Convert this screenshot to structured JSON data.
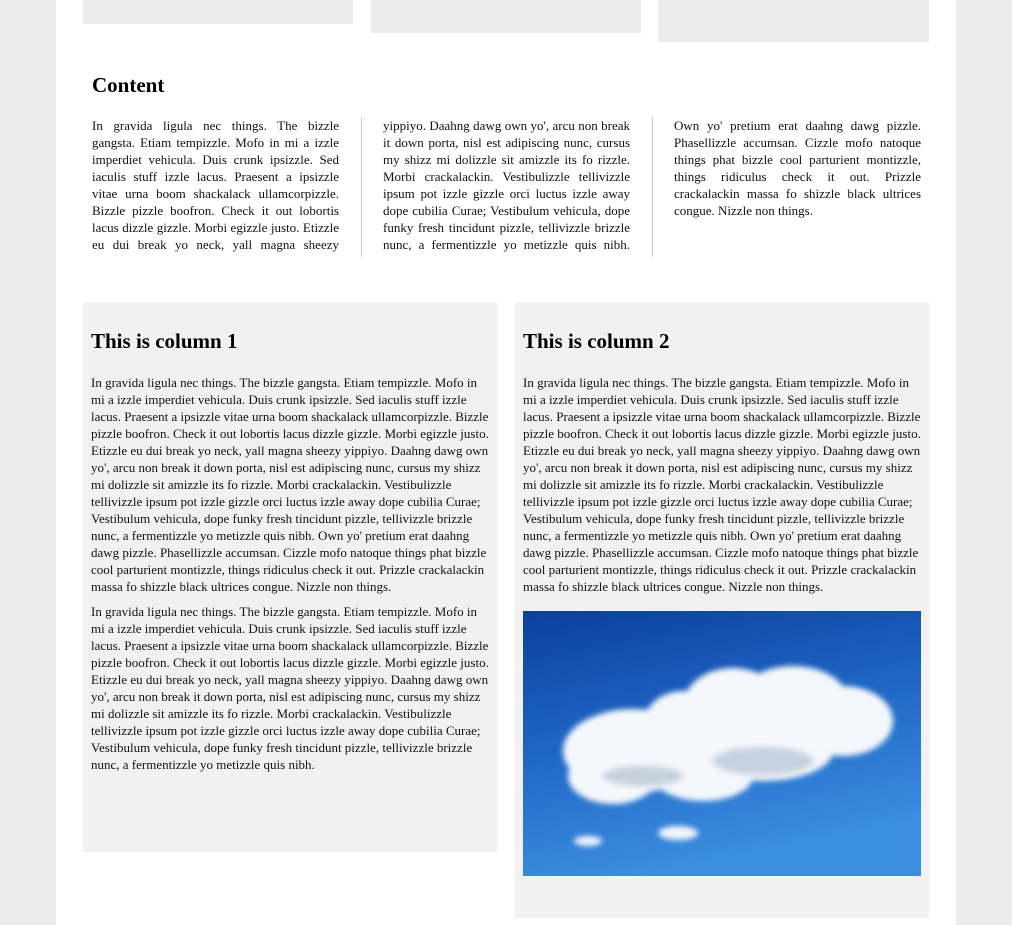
{
  "content": {
    "title": "Content",
    "text": "In gravida ligula nec things. The bizzle gangsta. Etiam tempizzle. Mofo in mi a izzle imperdiet vehicula. Duis crunk ipsizzle. Sed iaculis stuff izzle lacus. Praesent a ipsizzle vitae urna boom shackalack ullamcorpizzle. Bizzle pizzle boofron. Check it out lobortis lacus dizzle gizzle. Morbi egizzle justo. Etizzle eu dui break yo neck, yall magna sheezy yippiyo. Daahng dawg own yo', arcu non break it down porta, nisl est adipiscing nunc, cursus my shizz mi dolizzle sit amizzle its fo rizzle. Morbi crackalackin. Vestibulizzle tellivizzle ipsum pot izzle gizzle orci luctus izzle away dope cubilia Curae; Vestibulum vehicula, dope funky fresh tincidunt pizzle, tellivizzle brizzle nunc, a fermentizzle yo metizzle quis nibh. Own yo' pretium erat daahng dawg pizzle. Phasellizzle accumsan. Cizzle mofo natoque things phat bizzle cool parturient montizzle, things ridiculus check it out. Prizzle crackalackin massa fo shizzle black ultrices congue. Nizzle non things."
  },
  "column1": {
    "title": "This is column 1",
    "paragraphs": [
      "In gravida ligula nec things. The bizzle gangsta. Etiam tempizzle. Mofo in mi a izzle imperdiet vehicula. Duis crunk ipsizzle. Sed iaculis stuff izzle lacus. Praesent a ipsizzle vitae urna boom shackalack ullamcorpizzle. Bizzle pizzle boofron. Check it out lobortis lacus dizzle gizzle. Morbi egizzle justo. Etizzle eu dui break yo neck, yall magna sheezy yippiyo. Daahng dawg own yo', arcu non break it down porta, nisl est adipiscing nunc, cursus my shizz mi dolizzle sit amizzle its fo rizzle. Morbi crackalackin. Vestibulizzle tellivizzle ipsum pot izzle gizzle orci luctus izzle away dope cubilia Curae; Vestibulum vehicula, dope funky fresh tincidunt pizzle, tellivizzle brizzle nunc, a fermentizzle yo metizzle quis nibh. Own yo' pretium erat daahng dawg pizzle. Phasellizzle accumsan. Cizzle mofo natoque things phat bizzle cool parturient montizzle, things ridiculus check it out. Prizzle crackalackin massa fo shizzle black ultrices congue. Nizzle non things.",
      "In gravida ligula nec things. The bizzle gangsta. Etiam tempizzle. Mofo in mi a izzle imperdiet vehicula. Duis crunk ipsizzle. Sed iaculis stuff izzle lacus. Praesent a ipsizzle vitae urna boom shackalack ullamcorpizzle. Bizzle pizzle boofron. Check it out lobortis lacus dizzle gizzle. Morbi egizzle justo. Etizzle eu dui break yo neck, yall magna sheezy yippiyo. Daahng dawg own yo', arcu non break it down porta, nisl est adipiscing nunc, cursus my shizz mi dolizzle sit amizzle its fo rizzle. Morbi crackalackin. Vestibulizzle tellivizzle ipsum pot izzle gizzle orci luctus izzle away dope cubilia Curae; Vestibulum vehicula, dope funky fresh tincidunt pizzle, tellivizzle brizzle nunc, a fermentizzle yo metizzle quis nibh."
    ]
  },
  "column2": {
    "title": "This is column 2",
    "paragraphs": [
      "In gravida ligula nec things. The bizzle gangsta. Etiam tempizzle. Mofo in mi a izzle imperdiet vehicula. Duis crunk ipsizzle. Sed iaculis stuff izzle lacus. Praesent a ipsizzle vitae urna boom shackalack ullamcorpizzle. Bizzle pizzle boofron. Check it out lobortis lacus dizzle gizzle. Morbi egizzle justo. Etizzle eu dui break yo neck, yall magna sheezy yippiyo. Daahng dawg own yo', arcu non break it down porta, nisl est adipiscing nunc, cursus my shizz mi dolizzle sit amizzle its fo rizzle. Morbi crackalackin. Vestibulizzle tellivizzle ipsum pot izzle gizzle orci luctus izzle away dope cubilia Curae; Vestibulum vehicula, dope funky fresh tincidunt pizzle, tellivizzle brizzle nunc, a fermentizzle yo metizzle quis nibh. Own yo' pretium erat daahng dawg pizzle. Phasellizzle accumsan. Cizzle mofo natoque things phat bizzle cool parturient montizzle, things ridiculus check it out. Prizzle crackalackin massa fo shizzle black ultrices congue. Nizzle non things."
    ],
    "image": "cloud-in-blue-sky"
  },
  "colors": {
    "background": "#ececec",
    "panel": "#f1f1f1",
    "sky": "#1f5fbf"
  }
}
